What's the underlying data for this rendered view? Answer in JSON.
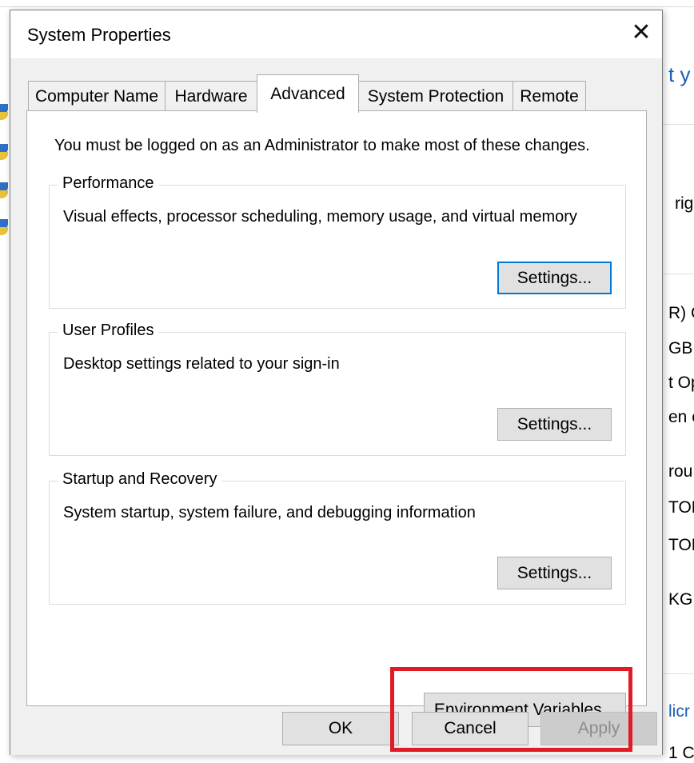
{
  "dialog": {
    "title": "System Properties",
    "close_glyph": "✕",
    "tabs": [
      {
        "label": "Computer Name"
      },
      {
        "label": "Hardware"
      },
      {
        "label": "Advanced"
      },
      {
        "label": "System Protection"
      },
      {
        "label": "Remote"
      }
    ],
    "active_tab": "Advanced",
    "admin_note": "You must be logged on as an Administrator to make most of these changes.",
    "groups": {
      "performance": {
        "label": "Performance",
        "description": "Visual effects, processor scheduling, memory usage, and virtual memory",
        "button": "Settings..."
      },
      "user_profiles": {
        "label": "User Profiles",
        "description": "Desktop settings related to your sign-in",
        "button": "Settings..."
      },
      "startup_recovery": {
        "label": "Startup and Recovery",
        "description": "System startup, system failure, and debugging information",
        "button": "Settings..."
      }
    },
    "env_button": "Environment Variables...",
    "footer": {
      "ok": "OK",
      "cancel": "Cancel",
      "apply": "Apply"
    }
  },
  "background": {
    "fragments": [
      "t y",
      "rig",
      "R) C",
      "GB",
      "t Op",
      "en c",
      "rou",
      "TOP",
      "TOF",
      "KGF",
      "licr",
      "1 C"
    ]
  },
  "colors": {
    "accent_focus": "#0078d7",
    "highlight": "#e01b24",
    "dialog_bg": "#f0f0f0"
  }
}
